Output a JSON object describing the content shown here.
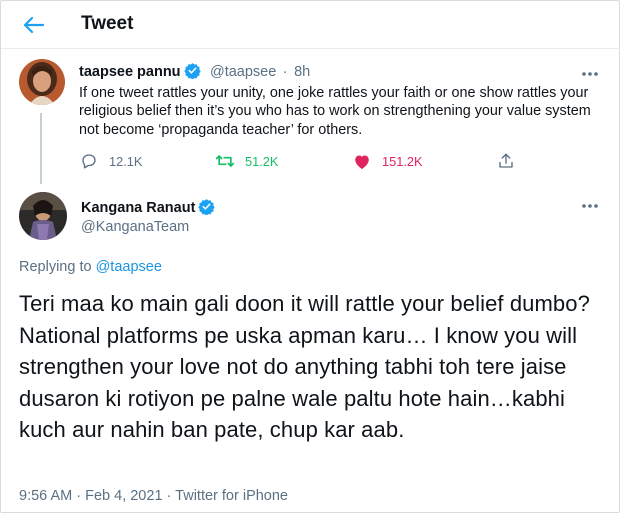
{
  "header": {
    "title": "Tweet"
  },
  "parent_tweet": {
    "author_name": "taapsee pannu",
    "author_handle": "@taapsee",
    "separator": "·",
    "time": "8h",
    "text": "If one tweet rattles your unity, one joke rattles your faith or one show rattles your religious belief then it’s you who has to work on strengthening your value system not become ‘propaganda teacher’ for others.",
    "replies": "12.1K",
    "retweets": "51.2K",
    "likes": "151.2K"
  },
  "main_tweet": {
    "author_name": "Kangana Ranaut",
    "author_handle": "@KanganaTeam",
    "replying_prefix": "Replying to",
    "replying_handle": "@taapsee",
    "text": "Teri maa ko main gali doon it will rattle your belief dumbo? National platforms pe uska apman karu… I know you will strengthen your love not do anything tabhi toh tere jaise dusaron ki rotiyon pe palne wale paltu hote hain…kabhi kuch aur nahin ban pate, chup kar aab.",
    "time": "9:56 AM",
    "date": "Feb 4, 2021",
    "separator": "·",
    "source": "Twitter for iPhone"
  },
  "colors": {
    "accent": "#1da1f2",
    "retweet": "#17bf63",
    "like": "#e0245e",
    "secondary_text": "#5b7083"
  },
  "icons": {
    "back": "arrow-left-icon",
    "verified": "verified-badge-icon",
    "more": "more-dots-icon",
    "reply": "reply-bubble-icon",
    "retweet": "retweet-icon",
    "like": "heart-filled-icon",
    "share": "share-icon"
  }
}
